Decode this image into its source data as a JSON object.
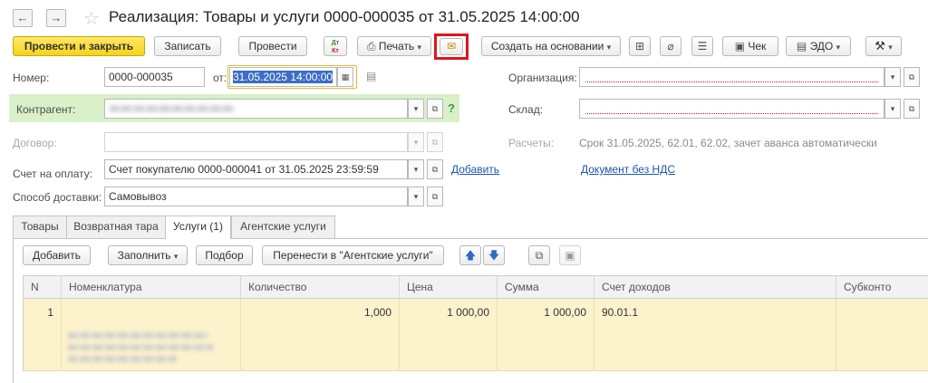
{
  "window": {
    "title": "Реализация: Товары и услуги 0000-000035 от 31.05.2025 14:00:00",
    "nav_back": "←",
    "nav_forward": "→",
    "star": "☆"
  },
  "toolbar": {
    "post_close": "Провести и закрыть",
    "save": "Записать",
    "post": "Провести",
    "dtkt_dt": "Дт",
    "dtkt_kt": "Кт",
    "print": "Печать",
    "email": "✉",
    "create_based": "Создать на основании",
    "check": "Чек",
    "edo": "ЭДО",
    "tools": "⚒",
    "dropdown_arrow": "▾"
  },
  "form": {
    "number_label": "Номер:",
    "number_value": "0000-000035",
    "date_label": "от:",
    "date_value": "31.05.2025 14:00:00",
    "org_label": "Организация:",
    "org_value": "",
    "counterparty_label": "Контрагент:",
    "counterparty_value": "",
    "help": "?",
    "warehouse_label": "Склад:",
    "warehouse_value": "",
    "contract_label": "Договор:",
    "contract_value": "",
    "settlements_label": "Расчеты:",
    "settlements_value": "Срок 31.05.2025, 62.01, 62.02, зачет аванса автоматически",
    "invoice_label": "Счет на оплату:",
    "invoice_value": "Счет покупателю 0000-000041 от 31.05.2025 23:59:59",
    "add_link": "Добавить",
    "no_vat_link": "Документ без НДС",
    "delivery_label": "Способ доставки:",
    "delivery_value": "Самовывоз"
  },
  "tabs": [
    {
      "label": "Товары"
    },
    {
      "label": "Возвратная тара"
    },
    {
      "label": "Услуги (1)"
    },
    {
      "label": "Агентские услуги"
    }
  ],
  "table_toolbar": {
    "add": "Добавить",
    "fill": "Заполнить",
    "pick": "Подбор",
    "move": "Перенести в \"Агентские услуги\"",
    "up": "🡅",
    "down": "🡇"
  },
  "table": {
    "columns": [
      "N",
      "Номенклатура",
      "Количество",
      "Цена",
      "Сумма",
      "Счет доходов",
      "Субконто"
    ],
    "rows": [
      {
        "n": "1",
        "item": "",
        "qty": "1,000",
        "price": "1 000,00",
        "sum": "1 000,00",
        "account": "90.01.1",
        "subconto": ""
      }
    ]
  }
}
